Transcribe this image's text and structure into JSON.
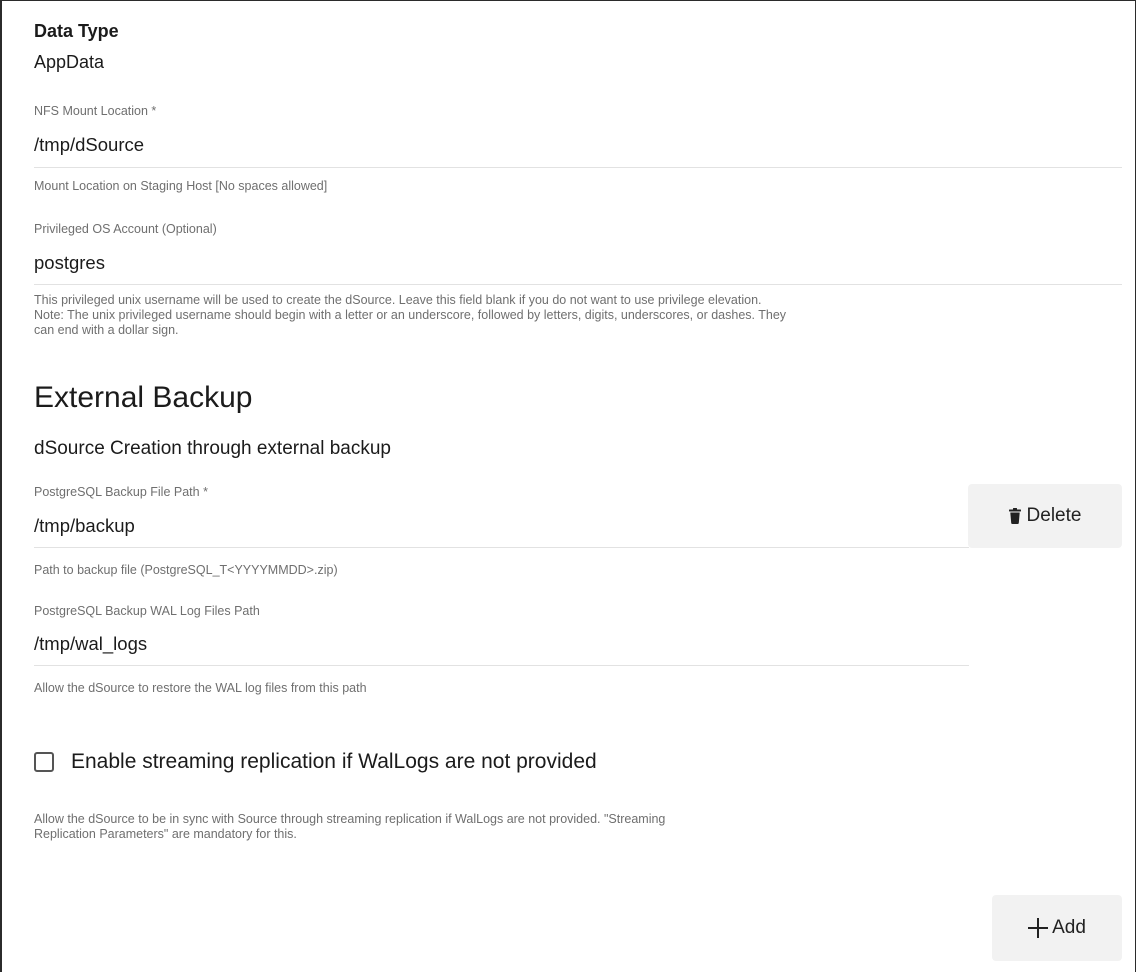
{
  "data_type": {
    "heading": "Data Type",
    "value": "AppData"
  },
  "nfs_mount": {
    "label": "NFS Mount Location *",
    "value": "/tmp/dSource",
    "helper": "Mount Location on Staging Host [No spaces allowed]"
  },
  "privileged_account": {
    "label": "Privileged OS Account (Optional)",
    "value": "postgres",
    "helper_line1": "This privileged unix username will be used to create the dSource. Leave this field blank if you do not want to use privilege elevation.",
    "helper_line2": "Note: The unix privileged username should begin with a letter or an underscore, followed by letters, digits, underscores, or dashes. They",
    "helper_line3": "can end with a dollar sign."
  },
  "external_backup": {
    "title": "External Backup",
    "subtitle": "dSource Creation through external backup",
    "backup_file_path": {
      "label": "PostgreSQL Backup File Path *",
      "value": "/tmp/backup",
      "helper": "Path to backup file (PostgreSQL_T<YYYYMMDD>.zip)"
    },
    "wal_path": {
      "label": "PostgreSQL Backup WAL Log Files Path",
      "value": "/tmp/wal_logs",
      "helper": "Allow the dSource to restore the WAL log files from this path"
    },
    "streaming": {
      "checked": false,
      "label": "Enable streaming replication if WalLogs are not provided",
      "helper_line1": "Allow the dSource to be in sync with Source through streaming replication if WalLogs are not provided. \"Streaming",
      "helper_line2": "Replication Parameters\" are mandatory for this."
    },
    "delete_label": "Delete",
    "delete_icon": "trash-icon"
  },
  "add_label": "Add",
  "add_icon": "plus-icon"
}
